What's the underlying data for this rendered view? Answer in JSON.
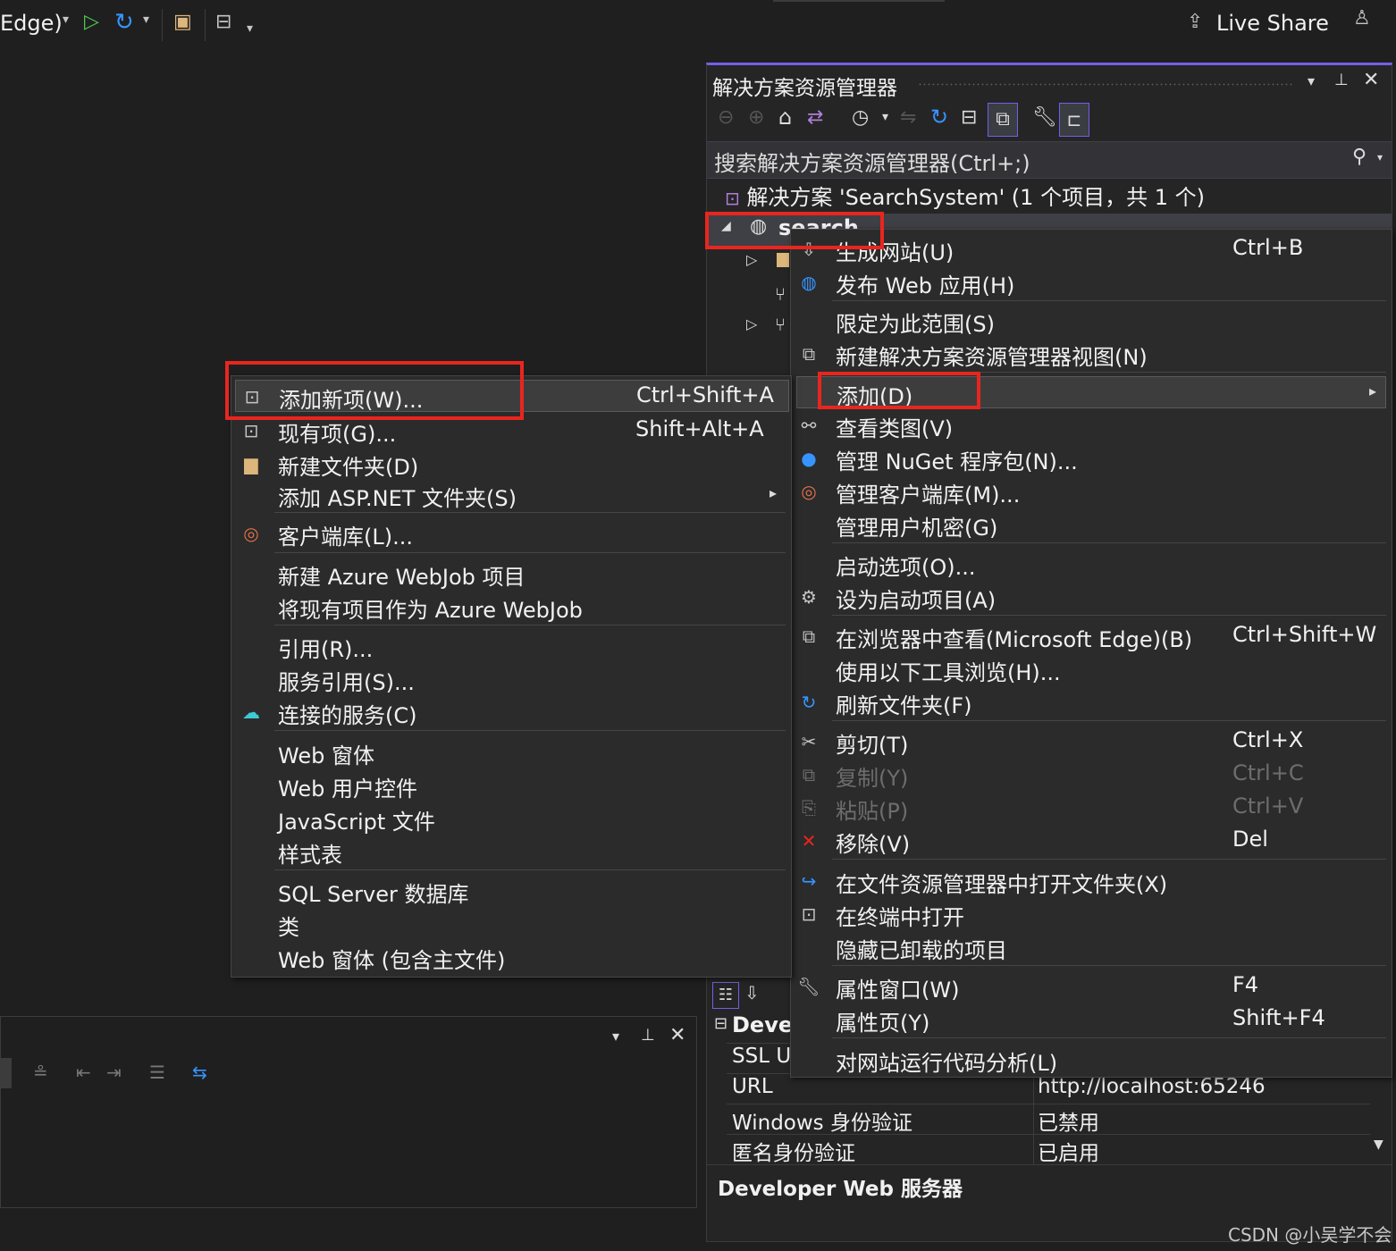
{
  "toolbar": {
    "debug_target": "Edge)",
    "live_share": "Live Share"
  },
  "solution_explorer": {
    "title": "解决方案资源管理器",
    "search_placeholder": "搜索解决方案资源管理器(Ctrl+;)",
    "solution_label": "解决方案 'SearchSystem' (1 个项目，共 1 个)",
    "project_name": "search"
  },
  "properties": {
    "section_title": "Deve",
    "rows": [
      {
        "name": "SSL U",
        "value": ""
      },
      {
        "name": "URL",
        "value": "http://localhost:65246"
      },
      {
        "name": "Windows 身份验证",
        "value": "已禁用"
      },
      {
        "name": "匿名身份验证",
        "value": "已启用"
      }
    ],
    "description_title": "Developer Web 服务器"
  },
  "context_menu": {
    "items": [
      {
        "label": "生成网站(U)",
        "shortcut": "Ctrl+B"
      },
      {
        "label": "发布 Web 应用(H)",
        "shortcut": ""
      },
      {
        "label": "限定为此范围(S)",
        "shortcut": ""
      },
      {
        "label": "新建解决方案资源管理器视图(N)",
        "shortcut": ""
      },
      {
        "label": "添加(D)",
        "shortcut": ""
      },
      {
        "label": "查看类图(V)",
        "shortcut": ""
      },
      {
        "label": "管理 NuGet 程序包(N)...",
        "shortcut": ""
      },
      {
        "label": "管理客户端库(M)...",
        "shortcut": ""
      },
      {
        "label": "管理用户机密(G)",
        "shortcut": ""
      },
      {
        "label": "启动选项(O)...",
        "shortcut": ""
      },
      {
        "label": "设为启动项目(A)",
        "shortcut": ""
      },
      {
        "label": "在浏览器中查看(Microsoft Edge)(B)",
        "shortcut": "Ctrl+Shift+W"
      },
      {
        "label": "使用以下工具浏览(H)...",
        "shortcut": ""
      },
      {
        "label": "刷新文件夹(F)",
        "shortcut": ""
      },
      {
        "label": "剪切(T)",
        "shortcut": "Ctrl+X"
      },
      {
        "label": "复制(Y)",
        "shortcut": "Ctrl+C"
      },
      {
        "label": "粘贴(P)",
        "shortcut": "Ctrl+V"
      },
      {
        "label": "移除(V)",
        "shortcut": "Del"
      },
      {
        "label": "在文件资源管理器中打开文件夹(X)",
        "shortcut": ""
      },
      {
        "label": "在终端中打开",
        "shortcut": ""
      },
      {
        "label": "隐藏已卸载的项目",
        "shortcut": ""
      },
      {
        "label": "属性窗口(W)",
        "shortcut": "F4"
      },
      {
        "label": "属性页(Y)",
        "shortcut": "Shift+F4"
      },
      {
        "label": "对网站运行代码分析(L)",
        "shortcut": ""
      }
    ]
  },
  "add_submenu": {
    "items": [
      {
        "label": "添加新项(W)...",
        "shortcut": "Ctrl+Shift+A"
      },
      {
        "label": "现有项(G)...",
        "shortcut": "Shift+Alt+A"
      },
      {
        "label": "新建文件夹(D)",
        "shortcut": ""
      },
      {
        "label": "添加 ASP.NET 文件夹(S)",
        "shortcut": ""
      },
      {
        "label": "客户端库(L)...",
        "shortcut": ""
      },
      {
        "label": "新建 Azure WebJob 项目",
        "shortcut": ""
      },
      {
        "label": "将现有项目作为 Azure WebJob",
        "shortcut": ""
      },
      {
        "label": "引用(R)...",
        "shortcut": ""
      },
      {
        "label": "服务引用(S)...",
        "shortcut": ""
      },
      {
        "label": "连接的服务(C)",
        "shortcut": ""
      },
      {
        "label": "Web 窗体",
        "shortcut": ""
      },
      {
        "label": "Web 用户控件",
        "shortcut": ""
      },
      {
        "label": "JavaScript 文件",
        "shortcut": ""
      },
      {
        "label": "样式表",
        "shortcut": ""
      },
      {
        "label": "SQL Server 数据库",
        "shortcut": ""
      },
      {
        "label": "类",
        "shortcut": ""
      },
      {
        "label": "Web 窗体 (包含主文件)",
        "shortcut": ""
      }
    ]
  },
  "watermark": "CSDN @小吴学不会",
  "colors": {
    "background": "#1f1f1f",
    "menu_bg": "#2b2b2b",
    "accent": "#7160e8",
    "highlight_box": "#e8261f",
    "play_green": "#4ec94e",
    "icon_blue": "#3794ff"
  }
}
